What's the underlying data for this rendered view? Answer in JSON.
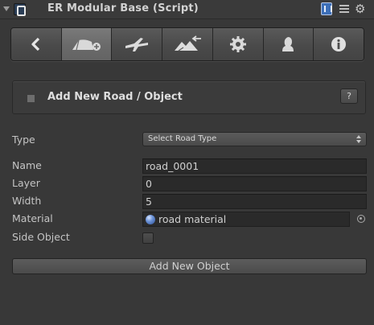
{
  "header": {
    "title": "ER Modular Base (Script)",
    "icons": [
      "foldout-arrow-icon",
      "script-enabled-icon",
      "help-book-icon",
      "preset-icon",
      "gear-icon"
    ]
  },
  "toolbar": {
    "buttons": [
      {
        "icon": "back-arrow-icon",
        "active": false
      },
      {
        "icon": "add-road-icon",
        "active": true
      },
      {
        "icon": "connection-icon",
        "active": false
      },
      {
        "icon": "terrain-icon",
        "active": false
      },
      {
        "icon": "gear-icon",
        "active": false
      },
      {
        "icon": "user-icon",
        "active": false
      },
      {
        "icon": "info-icon",
        "active": false
      }
    ]
  },
  "section": {
    "title": "Add New Road  /  Object",
    "help_label": "?"
  },
  "form": {
    "type_label": "Type",
    "type_value": "Select Road Type",
    "name_label": "Name",
    "name_value": "road_0001",
    "layer_label": "Layer",
    "layer_value": "0",
    "width_label": "Width",
    "width_value": "5",
    "material_label": "Material",
    "material_value": "road material",
    "side_object_label": "Side Object",
    "side_object_checked": false
  },
  "actions": {
    "add_label": "Add New Object"
  },
  "colors": {
    "background": "#383838",
    "active_button": "#6a6a6a",
    "input_background": "#2a2a2a"
  }
}
